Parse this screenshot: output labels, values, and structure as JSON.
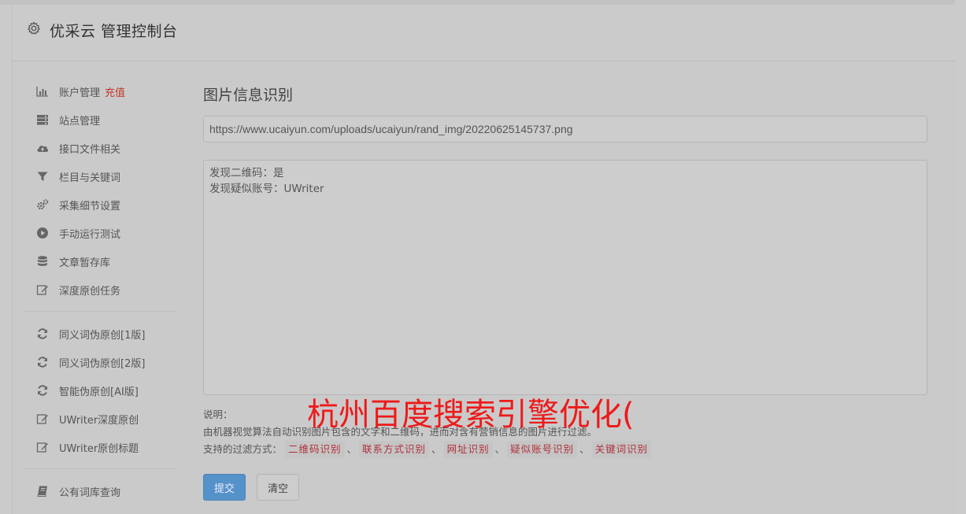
{
  "header": {
    "title": "优采云 管理控制台",
    "icon": "gear-icon"
  },
  "sidebar": {
    "group1": [
      {
        "label": "账户管理",
        "badge": "充值",
        "icon": "bar-chart-icon"
      },
      {
        "label": "站点管理",
        "icon": "server-icon"
      },
      {
        "label": "接口文件相关",
        "icon": "cloud-upload-icon"
      },
      {
        "label": "栏目与关键词",
        "icon": "filter-icon"
      },
      {
        "label": "采集细节设置",
        "icon": "cogs-icon"
      },
      {
        "label": "手动运行测试",
        "icon": "play-circle-icon"
      },
      {
        "label": "文章暂存库",
        "icon": "database-icon"
      },
      {
        "label": "深度原创任务",
        "icon": "edit-icon"
      }
    ],
    "group2": [
      {
        "label": "同义词伪原创[1版]",
        "icon": "refresh-icon"
      },
      {
        "label": "同义词伪原创[2版]",
        "icon": "refresh-icon"
      },
      {
        "label": "智能伪原创[AI版]",
        "icon": "refresh-icon"
      },
      {
        "label": "UWriter深度原创",
        "icon": "edit-icon"
      },
      {
        "label": "UWriter原创标题",
        "icon": "edit-icon"
      }
    ],
    "group3": [
      {
        "label": "公有词库查询",
        "icon": "book-icon"
      }
    ]
  },
  "main": {
    "title": "图片信息识别",
    "url_value": "https://www.ucaiyun.com/uploads/ucaiyun/rand_img/20220625145737.png",
    "result_lines": [
      "发现二维码：是",
      "发现疑似账号：UWriter"
    ],
    "desc_label": "说明：",
    "desc_text": "由机器视觉算法自动识别图片包含的文字和二维码，进而对含有营销信息的图片进行过滤。",
    "filter_label": "支持的过滤方式：",
    "filters": [
      "二维码识别",
      "联系方式识别",
      "网址识别",
      "疑似账号识别",
      "关键词识别"
    ],
    "filter_sep": "、",
    "submit_label": "提交",
    "clear_label": "清空"
  },
  "watermark": "杭州百度搜索引擎优化(",
  "colors": {
    "badge": "#c0392b",
    "primary_button": "#5592c9",
    "tag_text": "#b0303a",
    "watermark": "#ee1a1a"
  }
}
